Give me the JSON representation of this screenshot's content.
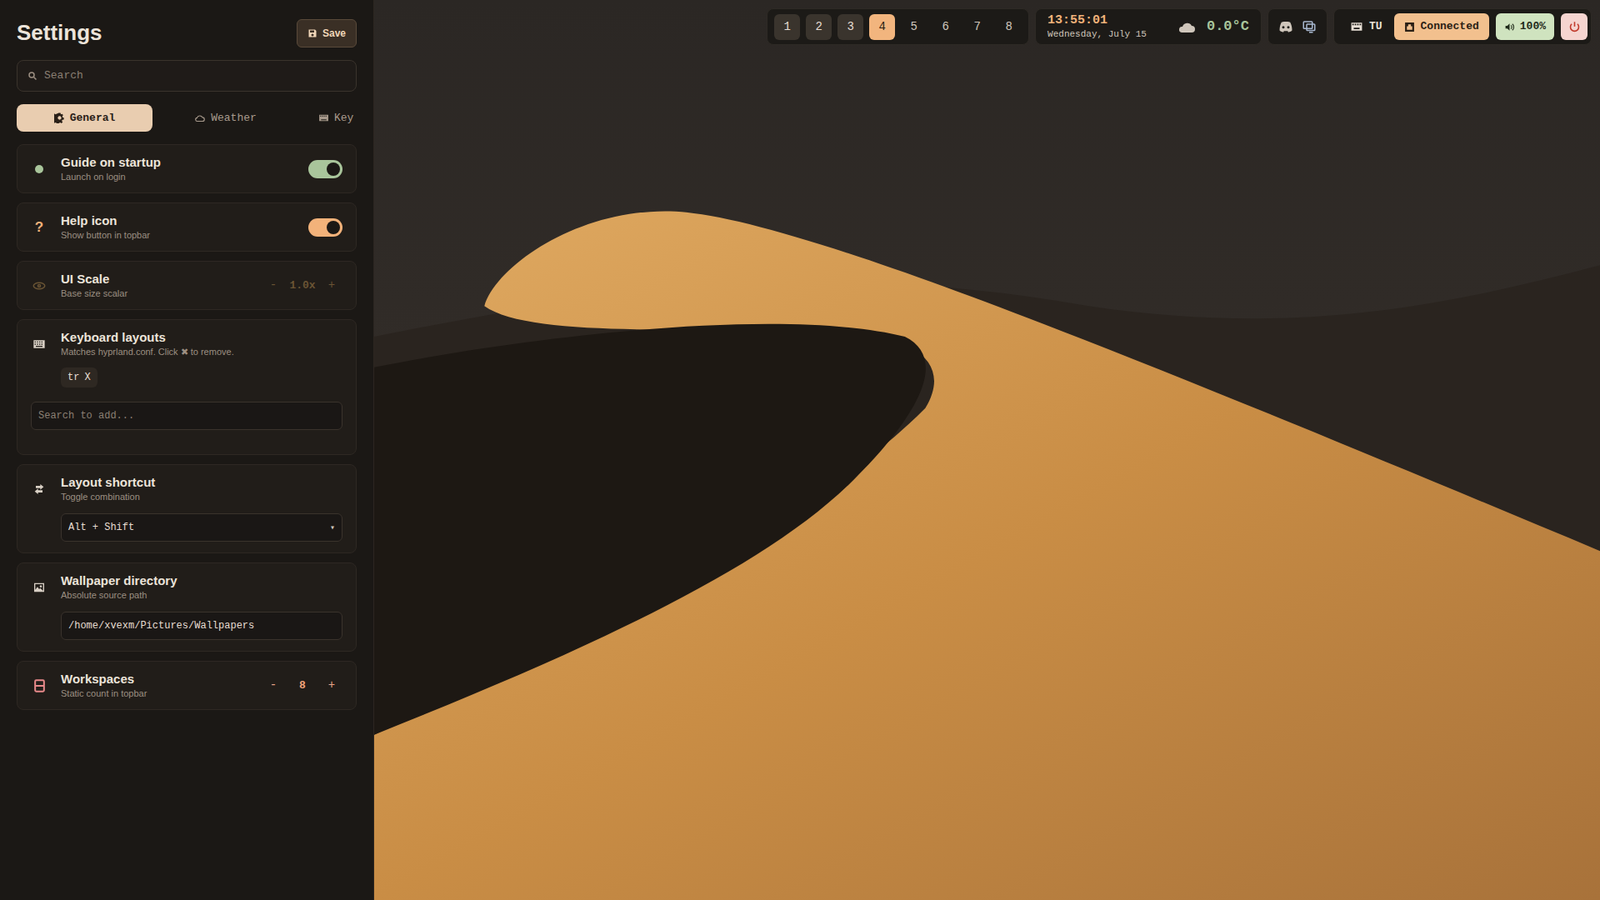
{
  "panel": {
    "title": "Settings",
    "save_label": "Save"
  },
  "search": {
    "placeholder": "Search"
  },
  "tabs": [
    {
      "label": "General",
      "selected": true
    },
    {
      "label": "Weather",
      "selected": false
    },
    {
      "label": "Key",
      "selected": false
    }
  ],
  "settings": [
    {
      "kind": "toggle",
      "title": "Guide on startup",
      "subtitle": "Launch on login",
      "on": true,
      "color": "#a9c59b"
    },
    {
      "kind": "toggle",
      "title": "Help icon",
      "subtitle": "Show button in topbar",
      "on": true,
      "color": "#f2b27a",
      "icon": "?"
    },
    {
      "kind": "stepper",
      "title": "UI Scale",
      "subtitle": "Base size scalar",
      "disabled": true,
      "minus": "-",
      "value": "1.0x",
      "plus": "+"
    },
    {
      "kind": "layouts",
      "title": "Keyboard layouts",
      "subtitle": "Matches hyprland.conf. Click ✖ to remove.",
      "chips": [
        {
          "label": "tr",
          "remove": "X"
        }
      ],
      "placeholder": "Search to add..."
    },
    {
      "kind": "select",
      "title": "Layout shortcut",
      "subtitle": "Toggle combination",
      "value": "Alt + Shift",
      "arrow": "▾"
    },
    {
      "kind": "text-input",
      "title": "Wallpaper directory",
      "subtitle": "Absolute source path",
      "value": "/home/xvexm/Pictures/Wallpapers"
    },
    {
      "kind": "stepper",
      "title": "Workspaces",
      "subtitle": "Static count in topbar",
      "disabled": false,
      "minus": "-",
      "value": "8",
      "plus": "+"
    }
  ],
  "topbar": {
    "workspaces": [
      {
        "label": "1",
        "occupied": true,
        "selected": false
      },
      {
        "label": "2",
        "occupied": true,
        "selected": false
      },
      {
        "label": "3",
        "occupied": true,
        "selected": false
      },
      {
        "label": "4",
        "occupied": true,
        "selected": true
      },
      {
        "label": "5",
        "occupied": false,
        "selected": false
      },
      {
        "label": "6",
        "occupied": false,
        "selected": false
      },
      {
        "label": "7",
        "occupied": false,
        "selected": false
      },
      {
        "label": "8",
        "occupied": false,
        "selected": false
      }
    ],
    "clock": {
      "time": "13:55:01",
      "date": "Wednesday, July 15"
    },
    "weather": {
      "temp": "0.0°C"
    },
    "keyboard": {
      "layout": "TU"
    },
    "network": {
      "label": "Connected"
    },
    "volume": {
      "label": "100%"
    }
  }
}
